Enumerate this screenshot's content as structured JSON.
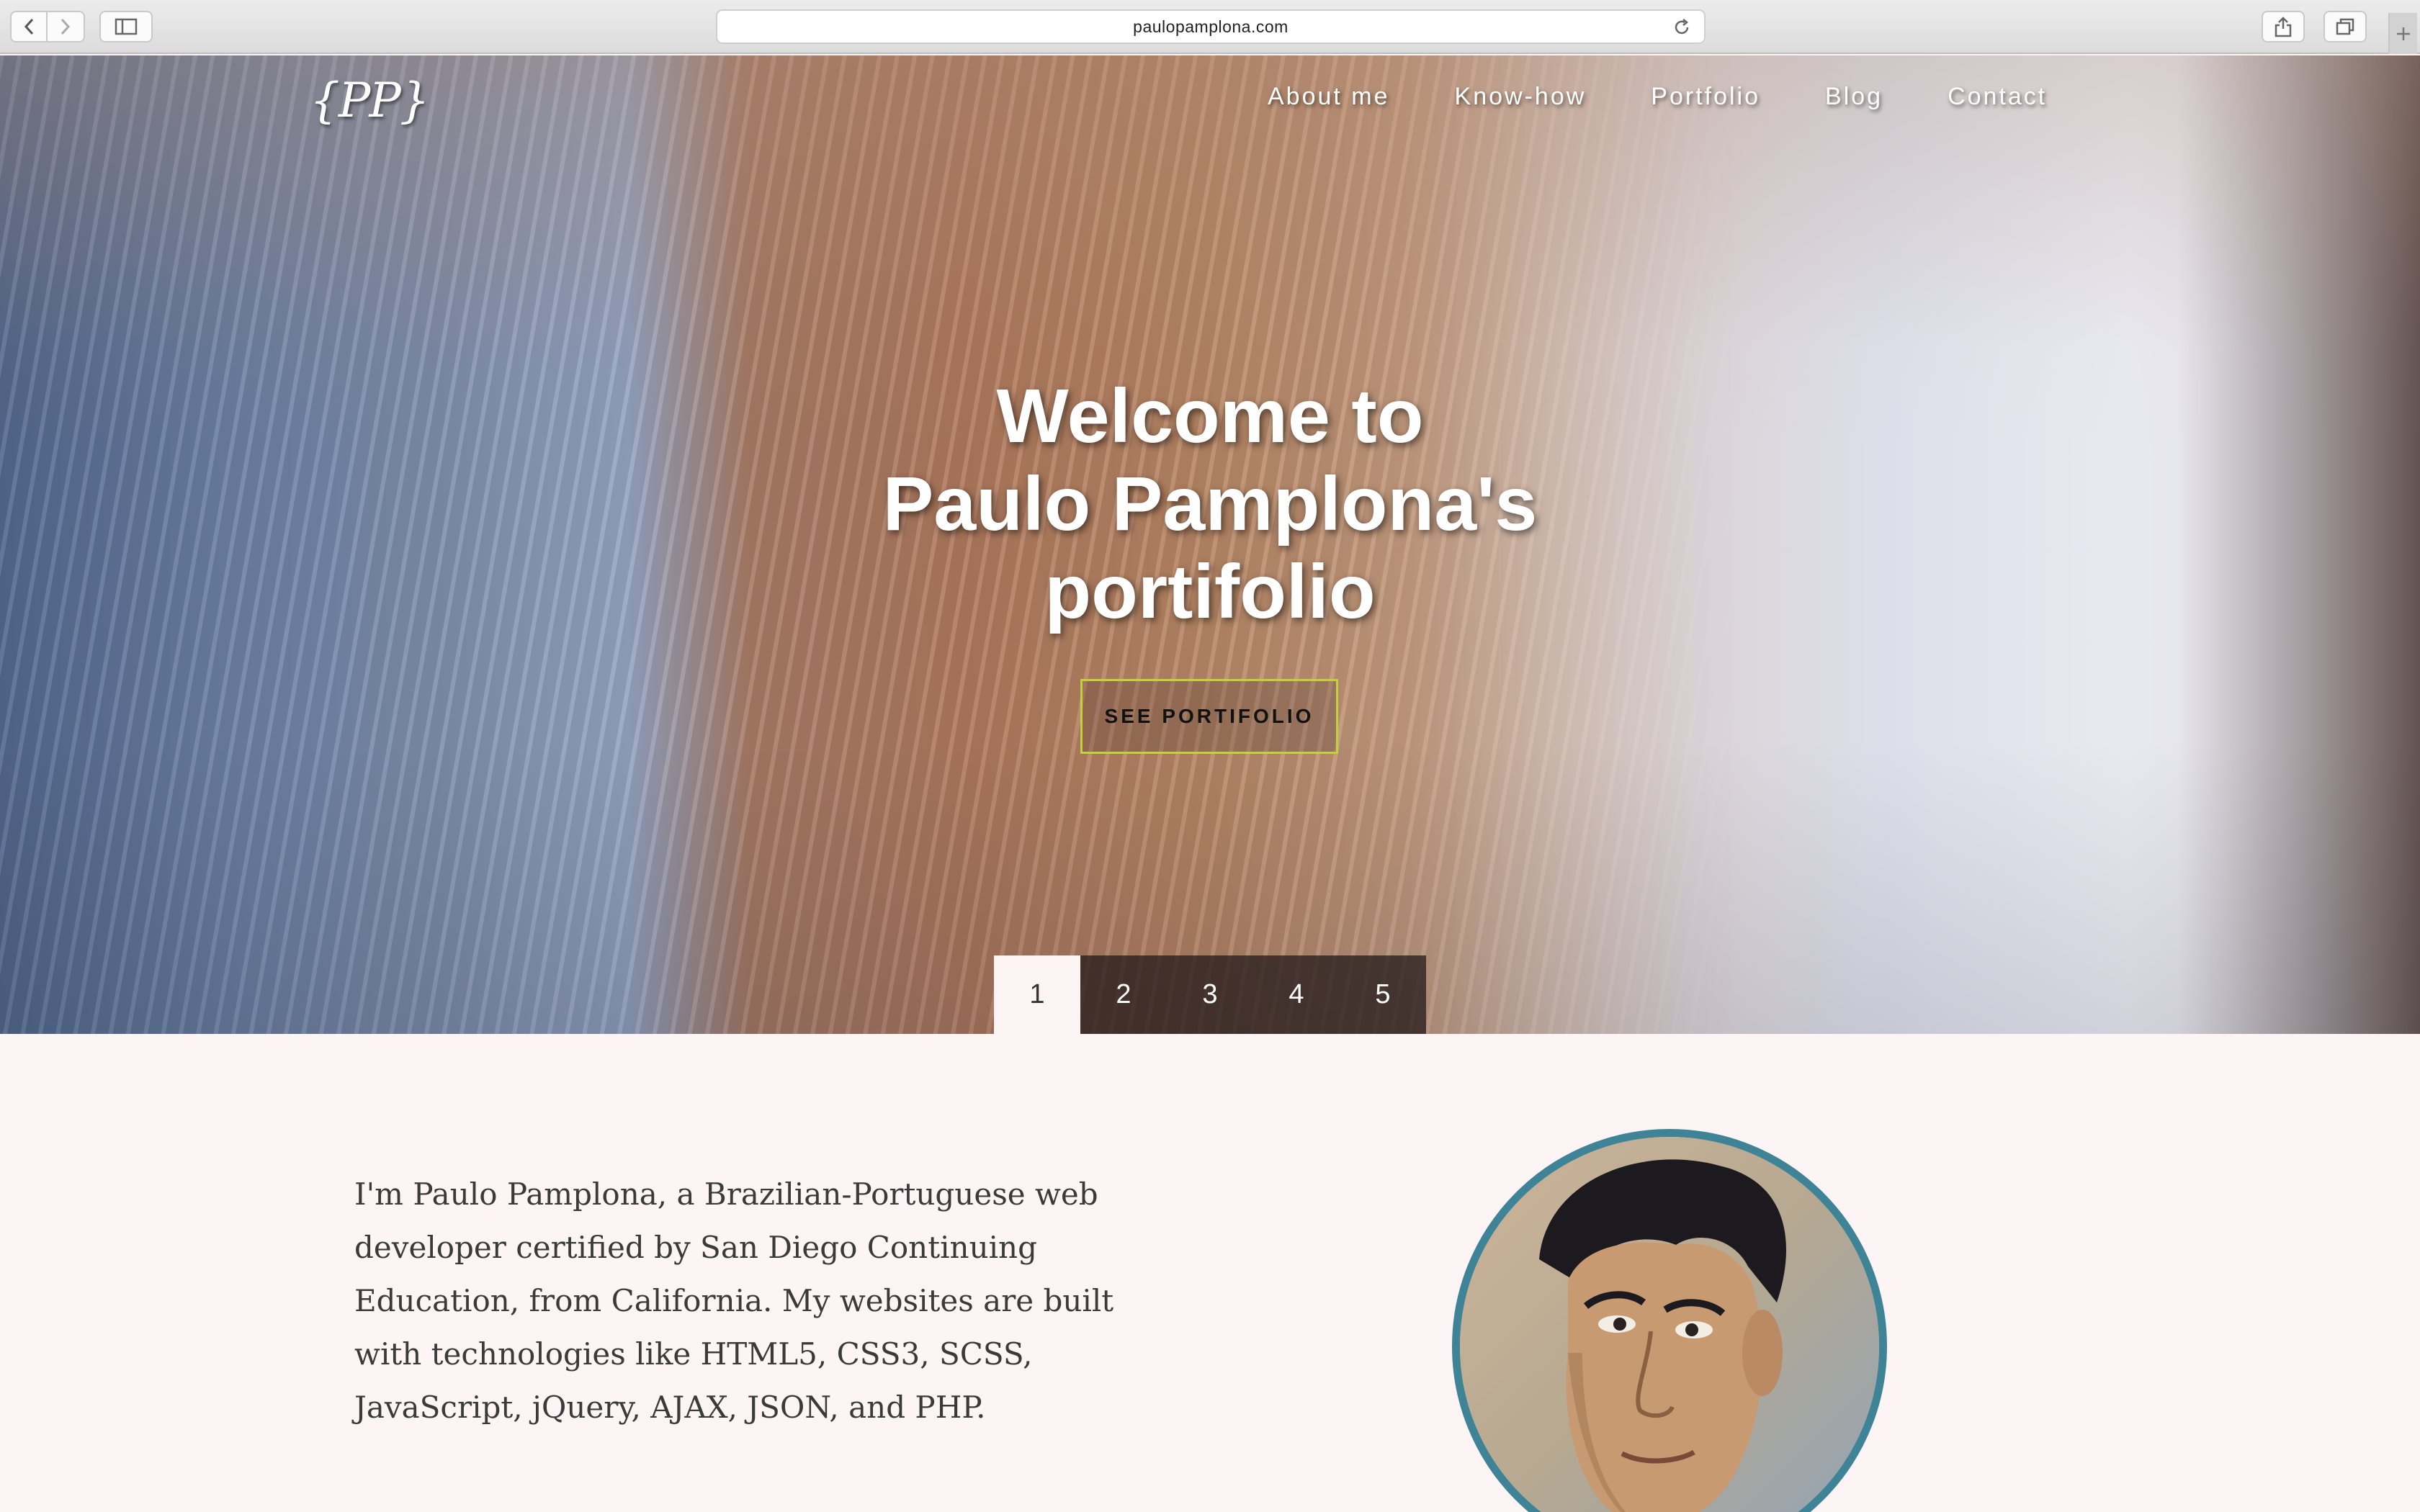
{
  "browser": {
    "url": "paulopamplona.com"
  },
  "site": {
    "logo_text": "{PP}",
    "nav": [
      {
        "label": "About me"
      },
      {
        "label": "Know-how"
      },
      {
        "label": "Portfolio"
      },
      {
        "label": "Blog"
      },
      {
        "label": "Contact"
      }
    ]
  },
  "hero": {
    "title_lines": [
      "Welcome to",
      "Paulo Pamplona's",
      "portifolio"
    ],
    "cta_label": "SEE PORTIFOLIO",
    "cta_border_color": "#c3d23a",
    "slides": [
      "1",
      "2",
      "3",
      "4",
      "5"
    ],
    "active_slide": "1"
  },
  "about": {
    "text": "I'm Paulo Pamplona, a Brazilian-Portuguese web developer certified by San Diego Continuing Education, from California. My websites are built with technologies like HTML5, CSS3, SCSS, JavaScript, jQuery, AJAX, JSON, and PHP.",
    "portrait_border_color": "#3e8496"
  }
}
